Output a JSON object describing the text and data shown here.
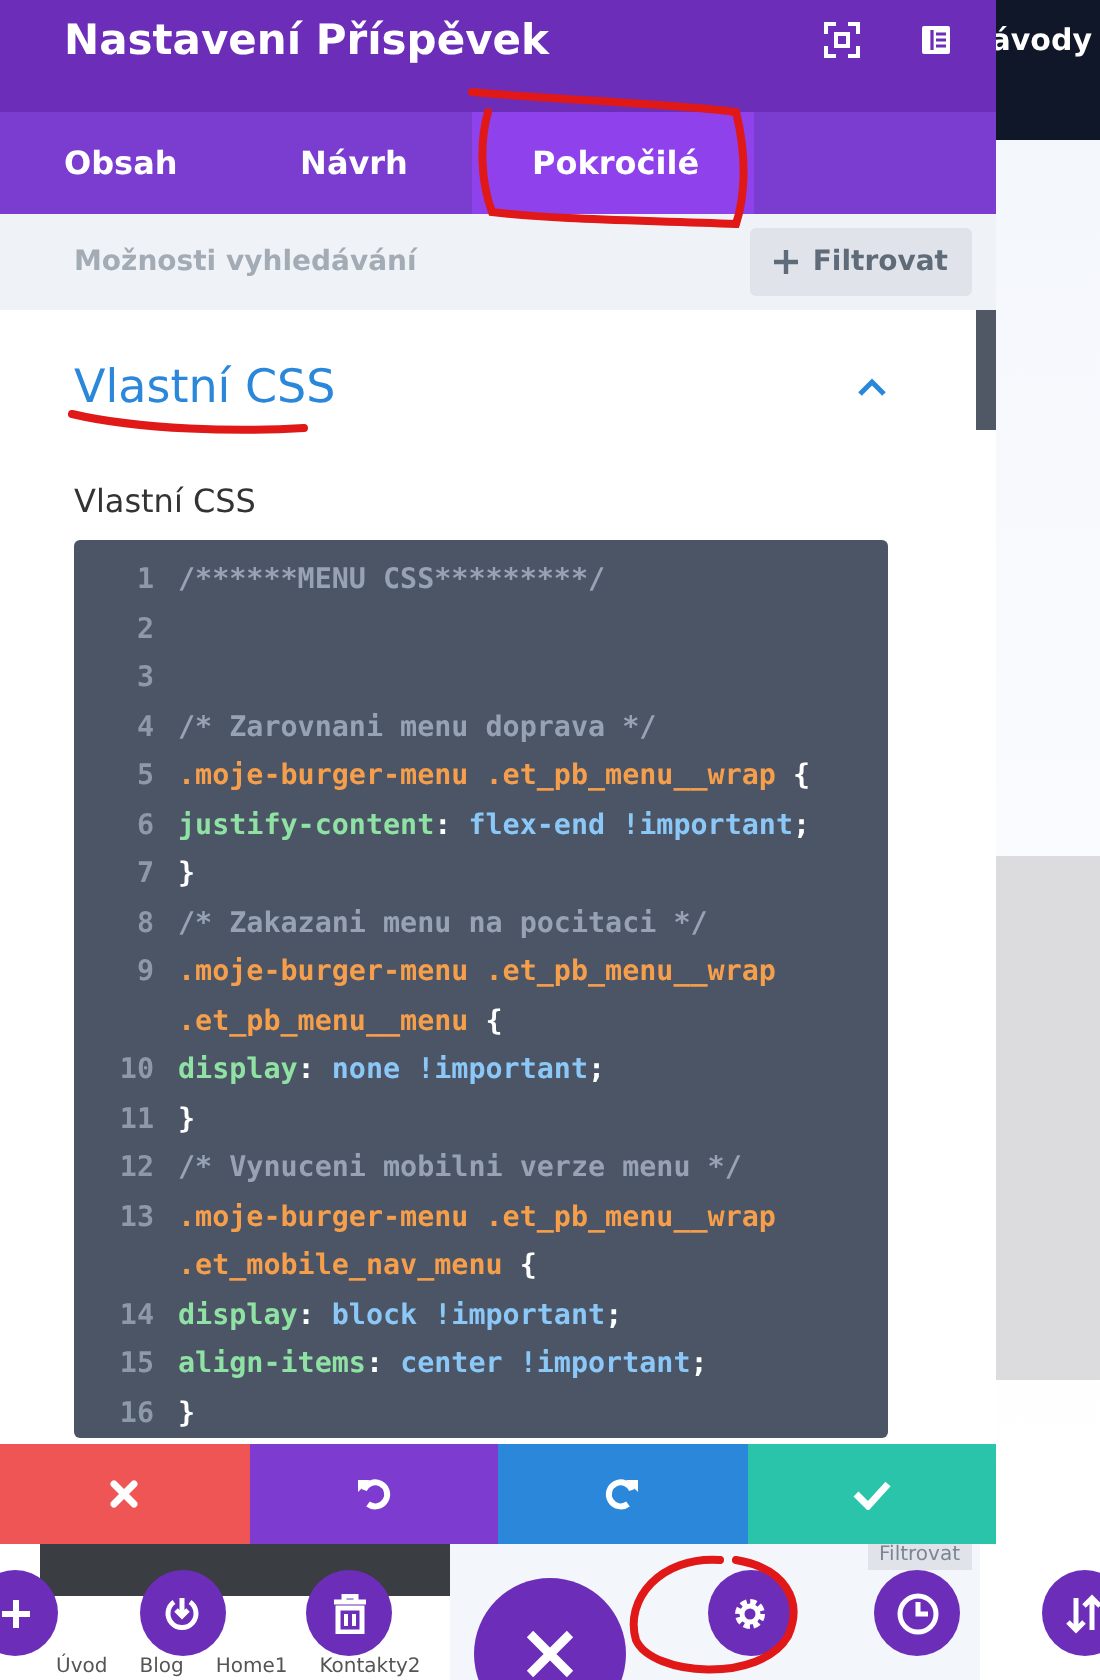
{
  "panel": {
    "title": "Nastavení Příspěvek",
    "tabs": [
      {
        "label": "Obsah",
        "selected": false
      },
      {
        "label": "Návrh",
        "selected": false
      },
      {
        "label": "Pokročilé",
        "selected": true
      }
    ],
    "search": {
      "placeholder": "Možnosti vyhledávání",
      "filter_button": "Filtrovat"
    },
    "section": {
      "title": "Vlastní CSS",
      "expanded": true,
      "field_label": "Vlastní CSS",
      "code_lines": [
        {
          "number": "1",
          "tokens": [
            {
              "kind": "comment",
              "text": "/******MENU CSS*********/"
            }
          ]
        },
        {
          "number": "2"
        },
        {
          "number": "3"
        },
        {
          "number": "4",
          "tokens": [
            {
              "kind": "comment",
              "text": "/* Zarovnani menu doprava */"
            }
          ]
        },
        {
          "number": "5",
          "tokens": [
            {
              "kind": "selector",
              "text": ".moje-burger-menu .et_pb_menu__wrap "
            },
            {
              "kind": "punct",
              "text": "{"
            }
          ]
        },
        {
          "number": "6",
          "tokens": [
            {
              "kind": "property",
              "text": "justify-content"
            },
            {
              "kind": "punct",
              "text": ": "
            },
            {
              "kind": "value",
              "text": "flex-end !important"
            },
            {
              "kind": "punct",
              "text": ";"
            }
          ]
        },
        {
          "number": "7",
          "tokens": [
            {
              "kind": "punct",
              "text": "}"
            }
          ]
        },
        {
          "number": "8",
          "tokens": [
            {
              "kind": "comment",
              "text": "/* Zakazani menu na pocitaci */"
            }
          ]
        },
        {
          "number": "9",
          "tokens": [
            {
              "kind": "selector",
              "text": ".moje-burger-menu .et_pb_menu__wrap .et_pb_menu__menu "
            },
            {
              "kind": "punct",
              "text": "{"
            }
          ]
        },
        {
          "number": "10",
          "tokens": [
            {
              "kind": "property",
              "text": "display"
            },
            {
              "kind": "punct",
              "text": ": "
            },
            {
              "kind": "value",
              "text": "none !important"
            },
            {
              "kind": "punct",
              "text": ";"
            }
          ]
        },
        {
          "number": "11",
          "tokens": [
            {
              "kind": "punct",
              "text": "}"
            }
          ]
        },
        {
          "number": "12",
          "tokens": [
            {
              "kind": "comment",
              "text": "/* Vynuceni mobilni verze menu */"
            }
          ]
        },
        {
          "number": "13",
          "tokens": [
            {
              "kind": "selector",
              "text": ".moje-burger-menu .et_pb_menu__wrap .et_mobile_nav_menu "
            },
            {
              "kind": "punct",
              "text": "{"
            }
          ]
        },
        {
          "number": "14",
          "tokens": [
            {
              "kind": "property",
              "text": "display"
            },
            {
              "kind": "punct",
              "text": ": "
            },
            {
              "kind": "value",
              "text": "block !important"
            },
            {
              "kind": "punct",
              "text": ";"
            }
          ]
        },
        {
          "number": "15",
          "tokens": [
            {
              "kind": "property",
              "text": "align-items"
            },
            {
              "kind": "punct",
              "text": ": "
            },
            {
              "kind": "value",
              "text": "center !important"
            },
            {
              "kind": "punct",
              "text": ";"
            }
          ]
        },
        {
          "number": "16",
          "tokens": [
            {
              "kind": "punct",
              "text": "}"
            }
          ]
        }
      ]
    }
  },
  "action_bar": [
    {
      "kind": "discard"
    },
    {
      "kind": "undo"
    },
    {
      "kind": "redo"
    },
    {
      "kind": "save"
    }
  ],
  "background_page": {
    "header_text": "ávody",
    "preview_filter": "Filtrovat",
    "nav_items": [
      "Úvod",
      "Blog",
      "Home1",
      "Kontakty2"
    ]
  },
  "floating_buttons": [
    {
      "kind": "add"
    },
    {
      "kind": "power"
    },
    {
      "kind": "trash"
    },
    {
      "kind": "close"
    },
    {
      "kind": "settings"
    },
    {
      "kind": "history"
    },
    {
      "kind": "sort"
    }
  ]
}
